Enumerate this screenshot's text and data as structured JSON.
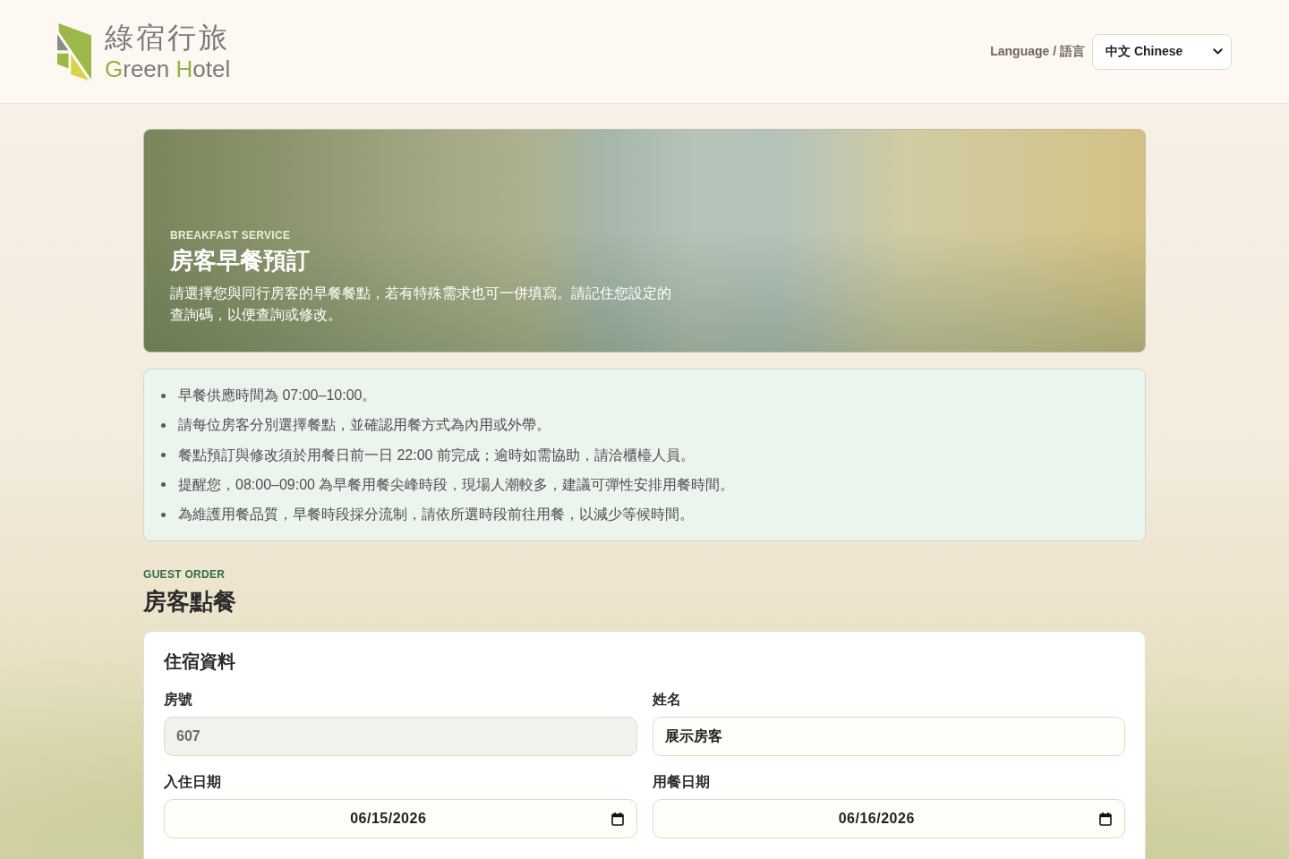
{
  "header": {
    "logo": {
      "name_zh": "綠宿行旅",
      "name_en": "Green Hotel"
    },
    "language": {
      "label": "Language / 語言",
      "value": "中文 Chinese"
    }
  },
  "hero": {
    "eyebrow": "BREAKFAST SERVICE",
    "title": "房客早餐預訂",
    "description": "請選擇您與同行房客的早餐餐點，若有特殊需求也可一併填寫。請記住您設定的查詢碼，以便查詢或修改。"
  },
  "notices": [
    "早餐供應時間為 07:00–10:00。",
    "請每位房客分別選擇餐點，並確認用餐方式為內用或外帶。",
    "餐點預訂與修改須於用餐日前一日 22:00 前完成；逾時如需協助，請洽櫃檯人員。",
    "提醒您，08:00–09:00 為早餐用餐尖峰時段，現場人潮較多，建議可彈性安排用餐時間。",
    "為維護用餐品質，早餐時段採分流制，請依所選時段前往用餐，以減少等候時間。"
  ],
  "section": {
    "eyebrow": "GUEST ORDER",
    "title": "房客點餐"
  },
  "form": {
    "title": "住宿資料",
    "fields": [
      {
        "label": "房號",
        "kind": "text",
        "value": "607",
        "disabled": true
      },
      {
        "label": "姓名",
        "kind": "text",
        "value": "展示房客",
        "disabled": false
      },
      {
        "label": "入住日期",
        "kind": "date",
        "value": "06/15/2026",
        "disabled": false
      },
      {
        "label": "用餐日期",
        "kind": "date",
        "value": "06/16/2026",
        "disabled": false
      }
    ]
  }
}
